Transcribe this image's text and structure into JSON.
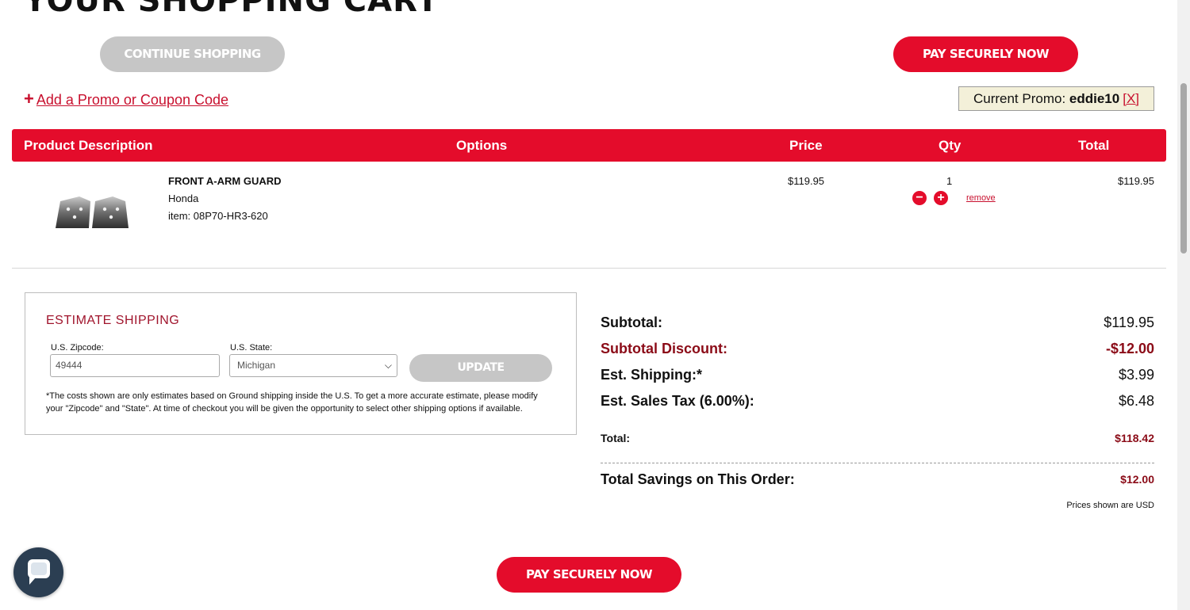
{
  "page": {
    "title": "YOUR SHOPPING CART"
  },
  "buttons": {
    "continue_shopping": "CONTINUE SHOPPING",
    "pay_top": "PAY SECURELY NOW",
    "pay_bottom": "PAY SECURELY NOW",
    "update": "UPDATE"
  },
  "promo": {
    "add_link": "Add a Promo or Coupon Code",
    "current_label": "Current Promo:",
    "current_code": "eddie10",
    "remove_label": "[X]"
  },
  "table": {
    "headers": [
      "Product Description",
      "Options",
      "Price",
      "Qty",
      "Total"
    ]
  },
  "cart_item": {
    "name": "FRONT A-ARM GUARD",
    "brand": "Honda",
    "item_no": "item: 08P70-HR3-620",
    "price": "$119.95",
    "qty": "1",
    "total": "$119.95",
    "remove": "remove"
  },
  "shipping": {
    "title": "ESTIMATE SHIPPING",
    "zip_label": "U.S. Zipcode:",
    "zip_value": "49444",
    "state_label": "U.S. State:",
    "state_value": "Michigan",
    "note": "*The costs shown are only estimates based on Ground shipping inside the U.S. To get a more accurate estimate, please modify your \"Zipcode\" and \"State\". At time of checkout you will be given the opportunity to select other shipping options if available."
  },
  "summary": {
    "subtotal_label": "Subtotal:",
    "subtotal": "$119.95",
    "discount_label": "Subtotal Discount:",
    "discount": "-$12.00",
    "shipping_label": "Est. Shipping:*",
    "shipping": "$3.99",
    "tax_label": "Est. Sales Tax (6.00%):",
    "tax": "$6.48",
    "total_label": "Total:",
    "total": "$118.42",
    "savings_label": "Total Savings on This Order:",
    "savings": "$12.00",
    "currency_note": "Prices shown are USD"
  },
  "colors": {
    "accent": "#e40c2b",
    "discount": "#8b0b17",
    "disabled": "#c6c6c6"
  }
}
